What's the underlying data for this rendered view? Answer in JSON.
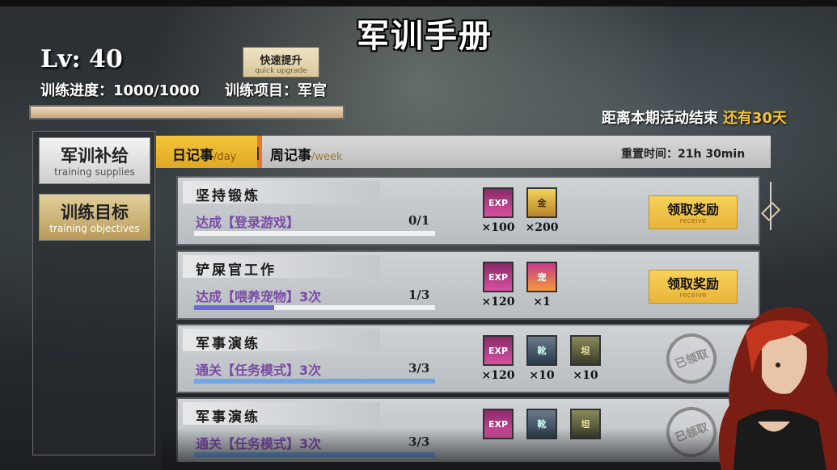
{
  "title": "军训手册",
  "level": {
    "label": "Lv: 40"
  },
  "quick_upgrade": {
    "zh": "快速提升",
    "en": "quick upgrade"
  },
  "progress": {
    "text": "训练进度：1000/1000",
    "fraction": 1.0
  },
  "project": {
    "text": "训练项目：军官"
  },
  "event": {
    "label": "距离本期活动结束",
    "remaining": "还有30天"
  },
  "sidebar": {
    "items": [
      {
        "zh": "军训补给",
        "en": "training supplies",
        "active": true
      },
      {
        "zh": "训练目标",
        "en": "training objectives",
        "active": false
      }
    ]
  },
  "tabs": {
    "day": {
      "zh": "日记事",
      "en": "/day"
    },
    "separator": "|",
    "week": {
      "zh": "周记事",
      "en": "/week"
    }
  },
  "reset_time": "重置时间：21h 30min",
  "tasks": [
    {
      "name": "坚持锻炼",
      "desc": "达成【登录游戏】",
      "count": "0/1",
      "progress": 0.0,
      "rewards": [
        {
          "icon": "exp-ticket-icon",
          "glyph": "EXP",
          "qty": "×100"
        },
        {
          "icon": "gold-coin-icon",
          "glyph": "金",
          "qty": "×200"
        }
      ],
      "status": "receive",
      "button": {
        "zh": "领取奖励",
        "en": "receive"
      }
    },
    {
      "name": "铲屎官工作",
      "desc": "达成【喂养宠物】3次",
      "count": "1/3",
      "progress": 0.333,
      "rewards": [
        {
          "icon": "exp-ticket-icon",
          "glyph": "EXP",
          "qty": "×120"
        },
        {
          "icon": "pet-food-icon",
          "glyph": "宠",
          "qty": "×1"
        }
      ],
      "status": "receive",
      "button": {
        "zh": "领取奖励",
        "en": "receive"
      }
    },
    {
      "name": "军事演练",
      "desc": "通关【任务模式】3次",
      "count": "3/3",
      "progress": 1.0,
      "rewards": [
        {
          "icon": "exp-ticket-icon",
          "glyph": "EXP",
          "qty": "×120"
        },
        {
          "icon": "boot-icon",
          "glyph": "靴",
          "qty": "×10"
        },
        {
          "icon": "tank-part-icon",
          "glyph": "坦",
          "qty": "×10"
        }
      ],
      "status": "claimed",
      "stamp": "已领取"
    },
    {
      "name": "军事演练",
      "desc": "通关【任务模式】3次",
      "count": "3/3",
      "progress": 1.0,
      "rewards": [
        {
          "icon": "exp-ticket-icon",
          "glyph": "EXP",
          "qty": ""
        },
        {
          "icon": "boot-icon",
          "glyph": "靴",
          "qty": ""
        },
        {
          "icon": "tank-part-icon",
          "glyph": "坦",
          "qty": ""
        }
      ],
      "status": "claimed",
      "stamp": "已领取"
    }
  ],
  "colors": {
    "accent": "#f2c53a",
    "remaining": "#f5c233",
    "progress": "#6b6bd6",
    "progress_done": "#6fa6e6"
  }
}
